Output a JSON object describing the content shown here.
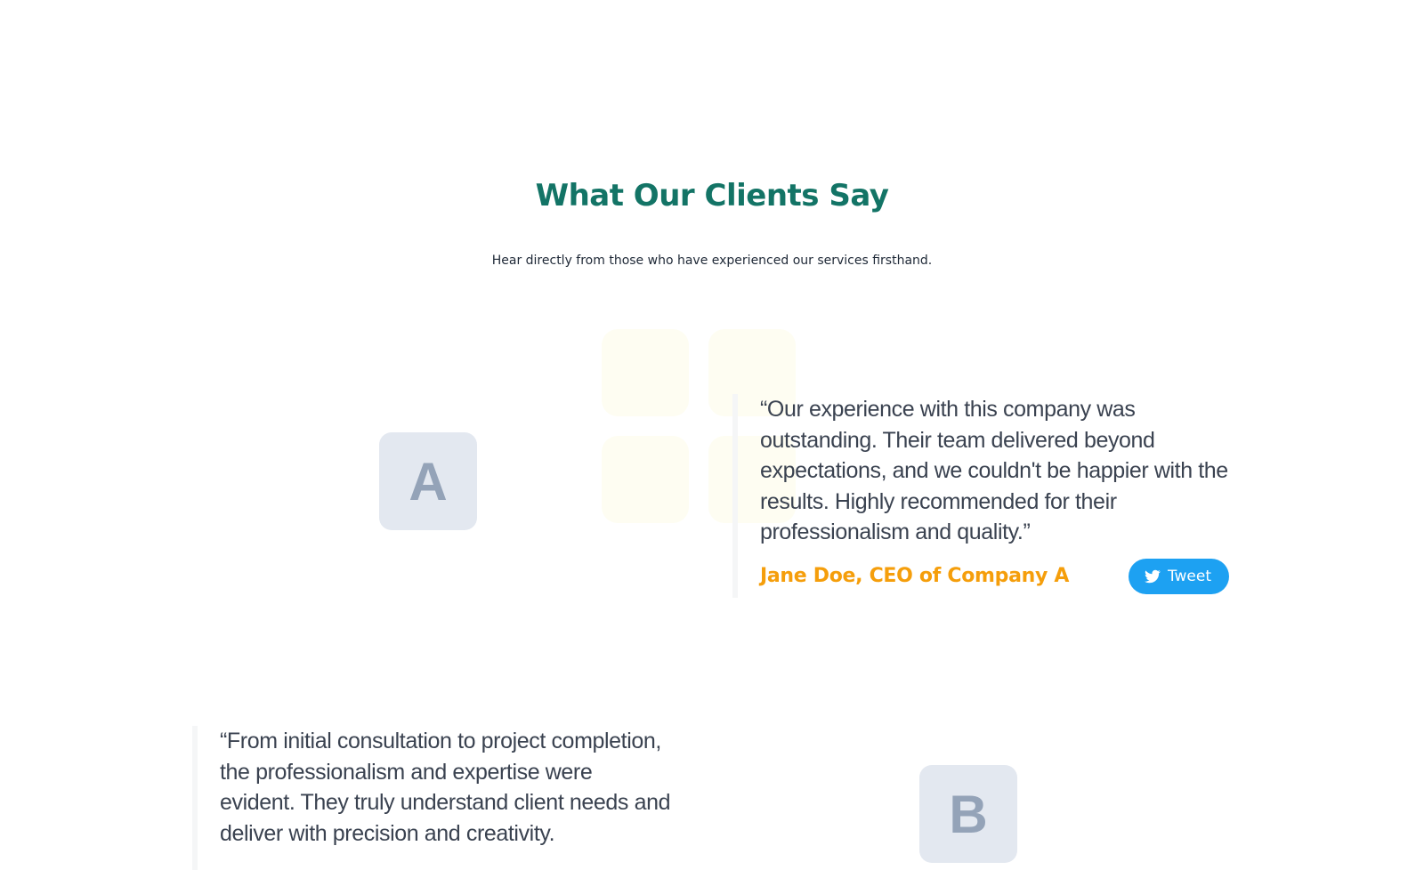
{
  "section": {
    "title": "What Our Clients Say",
    "subtitle": "Hear directly from those who have experienced our services firsthand."
  },
  "testimonials": [
    {
      "avatar_letter": "A",
      "quote": "“Our experience with this company was outstanding. Their team delivered beyond expectations, and we couldn't be happier with the results. Highly recommended for their professionalism and quality.”",
      "author": "Jane Doe, CEO of Company A",
      "tweet_label": "Tweet",
      "tweet_icon": "twitter-bird-icon"
    },
    {
      "avatar_letter": "B",
      "quote": "“From initial consultation to project completion, the professionalism and expertise were evident. They truly understand client needs and deliver with precision and creativity."
    }
  ],
  "colors": {
    "title": "#137466",
    "author": "#f59e0b",
    "tweet_button": "#1da1f2",
    "avatar_bg": "#e3e8f0",
    "avatar_letter": "#94a3b8"
  }
}
